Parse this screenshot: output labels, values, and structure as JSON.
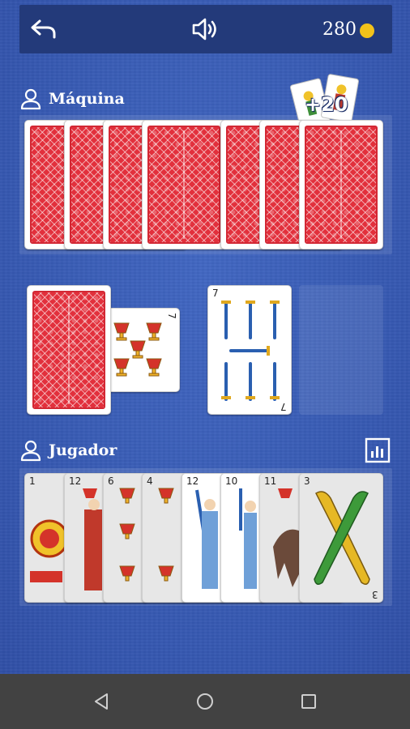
{
  "topbar": {
    "back_icon": "undo-arrow-icon",
    "sound_icon": "speaker-icon",
    "coins": "280",
    "coin_color": "#f2c21a"
  },
  "opponent": {
    "name": "Máquina",
    "bonus": "+20",
    "cards_in_hand": 7
  },
  "table": {
    "deck": "face-down",
    "trump_card": {
      "number": "7",
      "suit": "copas"
    },
    "played_card": {
      "number": "7",
      "suit": "espadas"
    }
  },
  "player": {
    "name": "Jugador",
    "stats_icon": "bar-chart-icon",
    "hand": [
      {
        "number": "1",
        "suit": "oros"
      },
      {
        "number": "12",
        "suit": "copas"
      },
      {
        "number": "6",
        "suit": "copas"
      },
      {
        "number": "4",
        "suit": "copas"
      },
      {
        "number": "12",
        "suit": "espadas"
      },
      {
        "number": "10",
        "suit": "espadas"
      },
      {
        "number": "11",
        "suit": "copas"
      },
      {
        "number": "3",
        "suit": "bastos"
      }
    ]
  },
  "navbar": {
    "back": "nav-back-icon",
    "home": "nav-home-icon",
    "recents": "nav-recents-icon"
  },
  "colors": {
    "felt": "#3a5bb4",
    "topbar": "#233a7a",
    "card_back": "#e2303c"
  }
}
